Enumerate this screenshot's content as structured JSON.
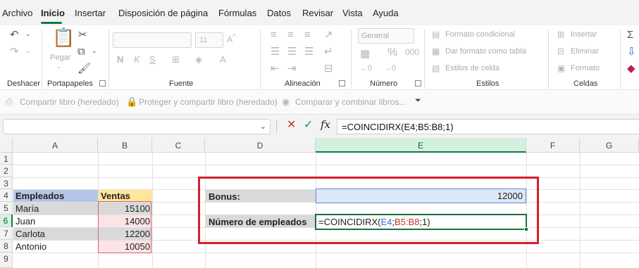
{
  "menu": {
    "tabs": [
      "Archivo",
      "Inicio",
      "Insertar",
      "Disposición de página",
      "Fórmulas",
      "Datos",
      "Revisar",
      "Vista",
      "Ayuda"
    ],
    "active": "Inicio"
  },
  "ribbon": {
    "groups": {
      "deshacer": "Deshacer",
      "portapapeles": "Portapapeles",
      "fuente": "Fuente",
      "alineacion": "Alineación",
      "numero": "Número",
      "estilos": "Estilos",
      "celdas": "Celdas"
    },
    "pegar": "Pegar",
    "font_size": "11",
    "number_format": "General",
    "estilos": {
      "formato_condicional": "Formato condicional",
      "dar_formato_tabla": "Dar formato como tabla",
      "estilos_celda": "Estilos de celda"
    },
    "celdas": {
      "insertar": "Insertar",
      "eliminar": "Eliminar",
      "formato": "Formato"
    }
  },
  "share_bar": {
    "compartir": "Compartir libro (heredado)",
    "proteger": "Proteger y compartir libro (heredado)",
    "comparar": "Comparar y combinar libros..."
  },
  "formula_bar": {
    "fx": "fx",
    "formula": "=COINCIDIRX(E4;B5:B8;1)"
  },
  "columns": [
    "A",
    "B",
    "C",
    "D",
    "E",
    "F",
    "G"
  ],
  "rows": [
    "1",
    "2",
    "3",
    "4",
    "5",
    "6",
    "7",
    "8",
    "9"
  ],
  "table": {
    "header_a": "Empleados",
    "header_b": "Ventas",
    "rows": [
      {
        "name": "María",
        "value": "15100"
      },
      {
        "name": "Juan",
        "value": "14000"
      },
      {
        "name": "Carlota",
        "value": "12200"
      },
      {
        "name": "Antonio",
        "value": "10050"
      }
    ]
  },
  "calc": {
    "bonus_label": "Bonus:",
    "bonus_value": "12000",
    "count_label": "Número de empleados",
    "formula_prefix": "=COINCIDIRX(",
    "ref1": "E4",
    "sep1": ";",
    "ref2": "B5:B8",
    "suffix": ";1)"
  }
}
